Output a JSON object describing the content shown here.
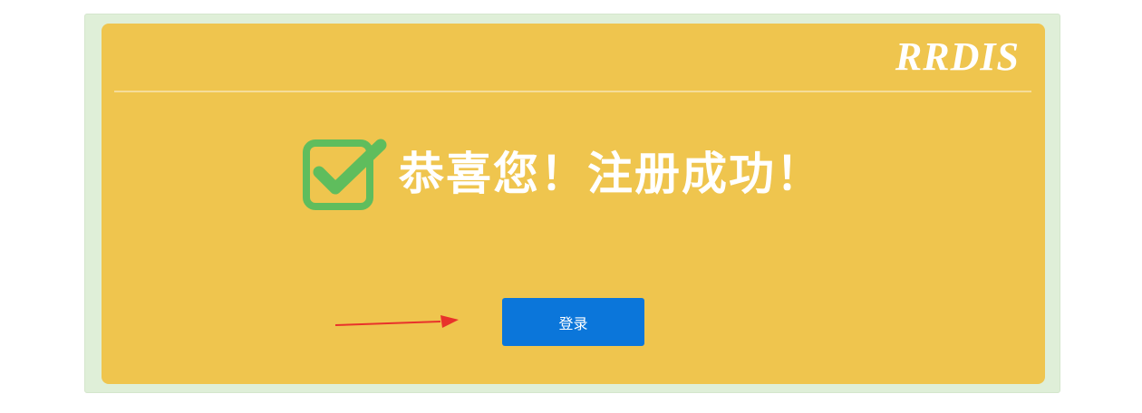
{
  "brand": {
    "name": "RRDIS"
  },
  "message": {
    "text": "恭喜您！注册成功！",
    "icon": "check-square-icon",
    "icon_color": "#5fbd5d"
  },
  "actions": {
    "login_label": "登录"
  },
  "colors": {
    "card_background": "#efc54e",
    "frame_background": "#dfefd8",
    "button_background": "#0b76da",
    "arrow": "#e8322b"
  }
}
